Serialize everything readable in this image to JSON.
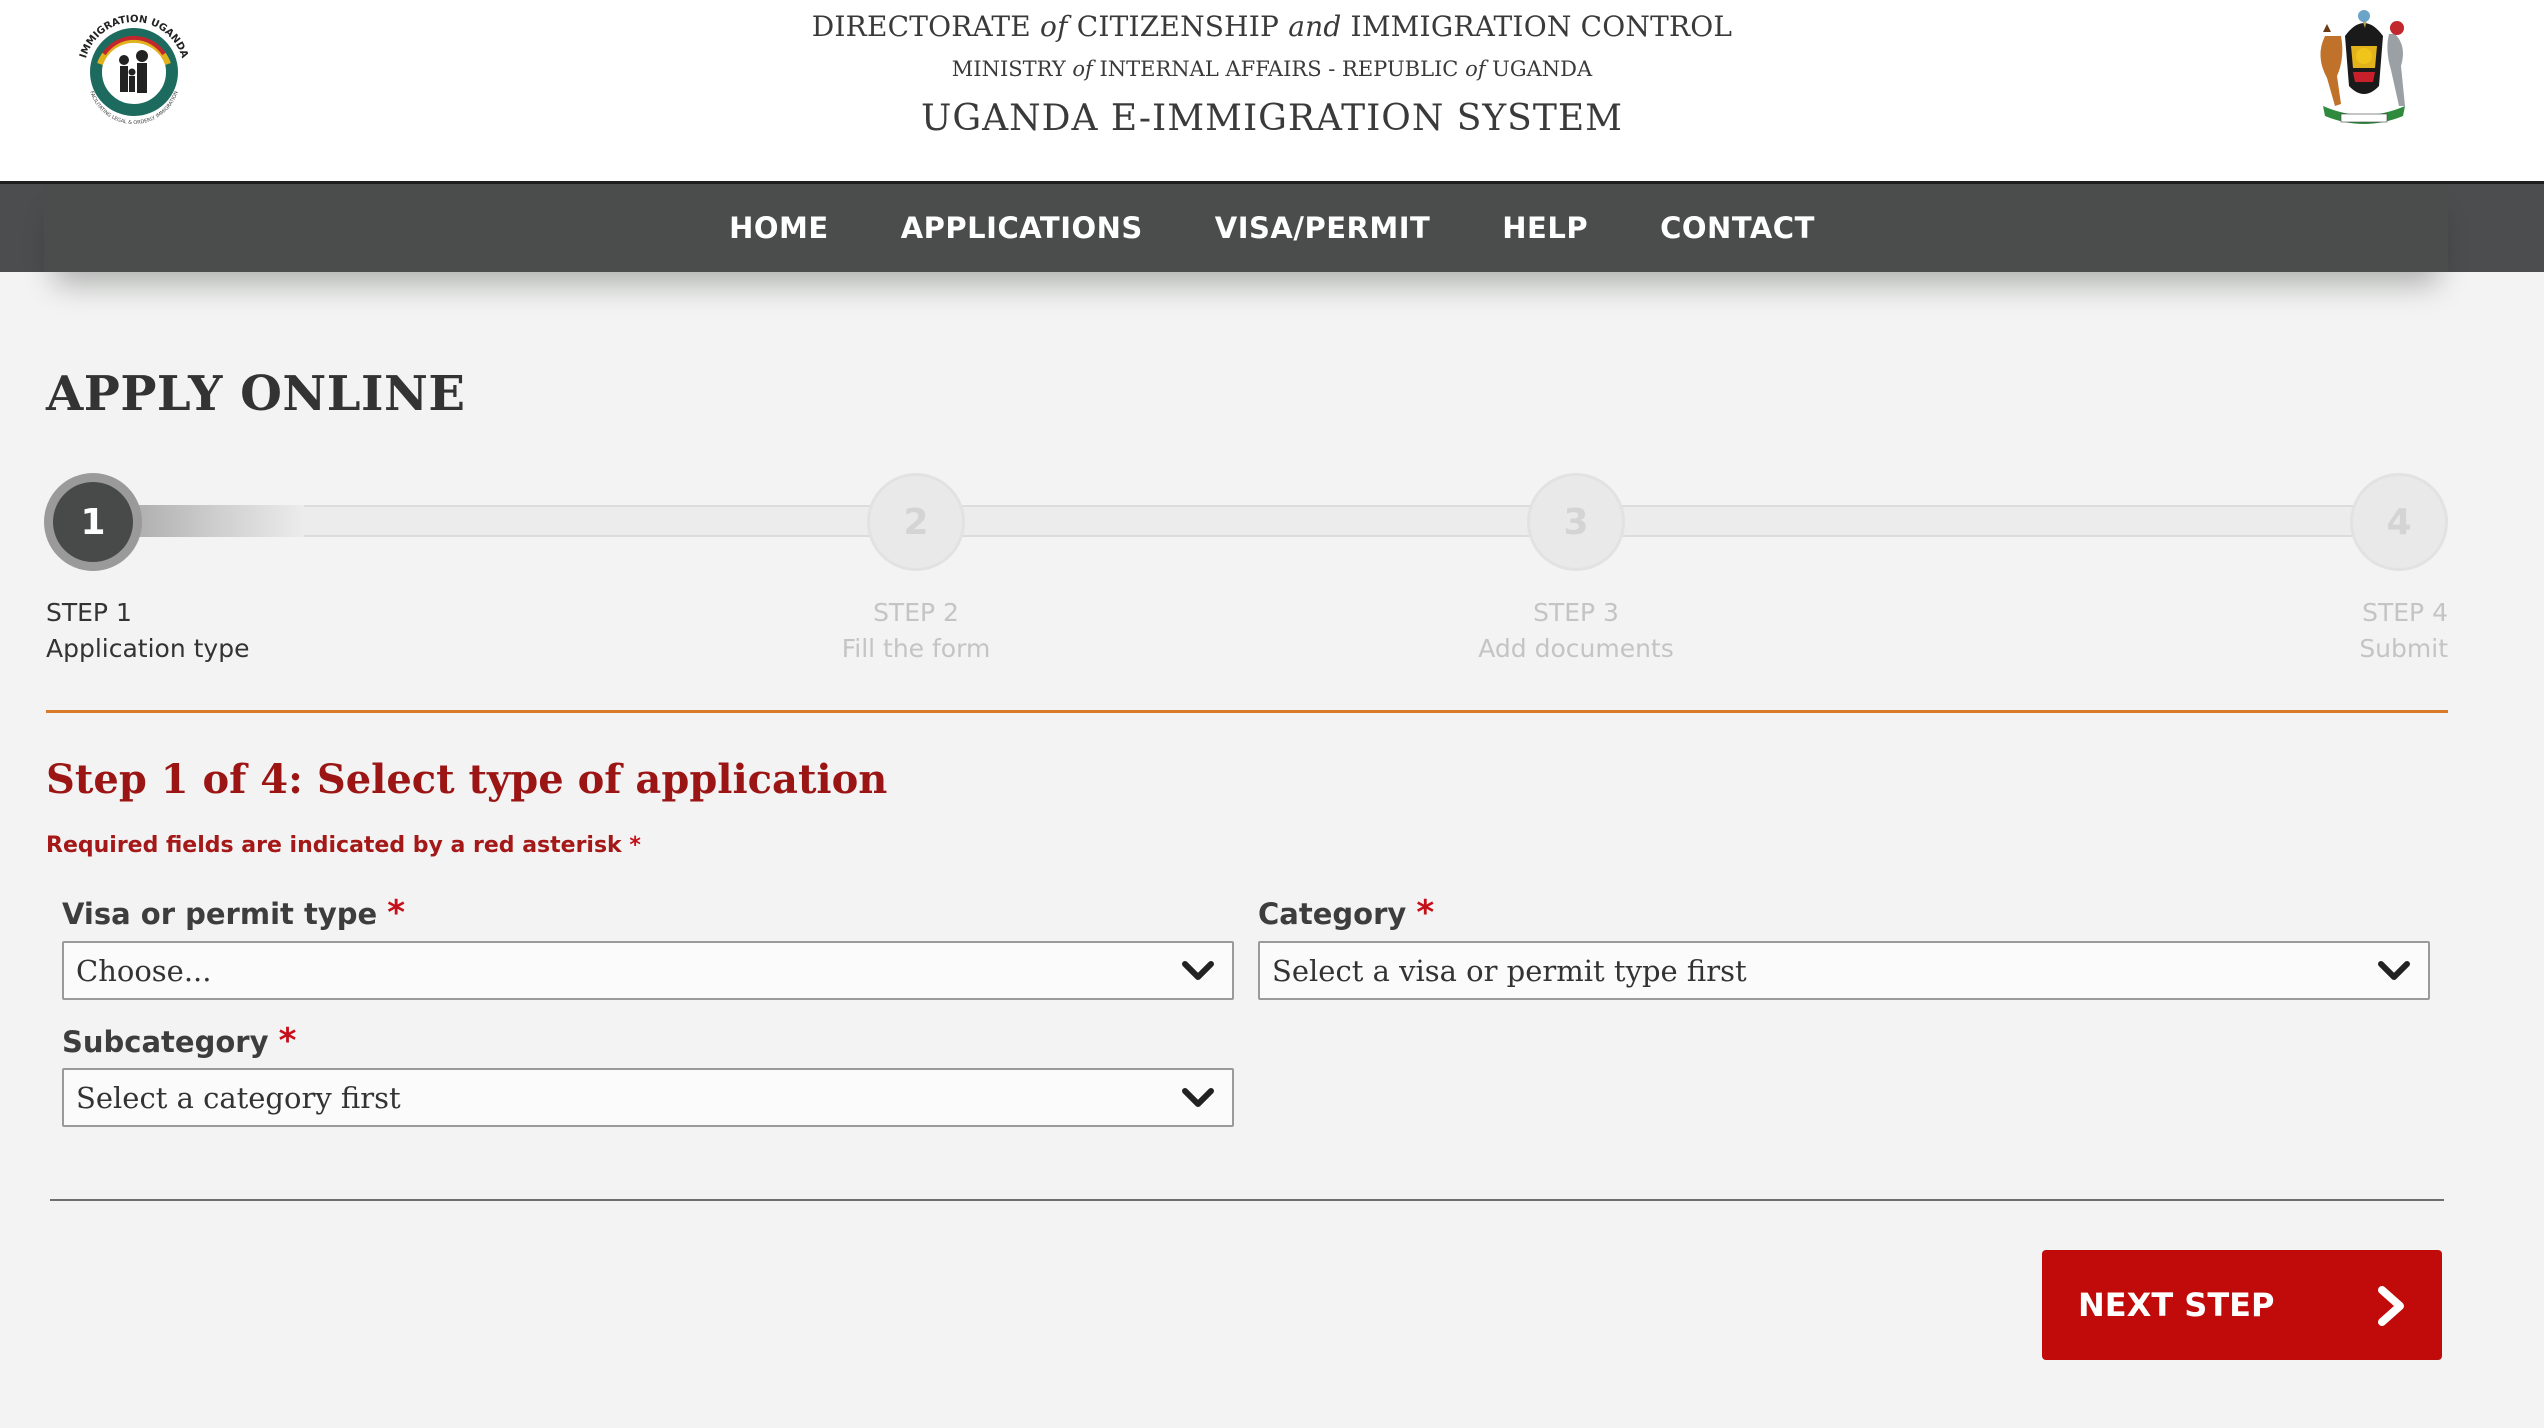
{
  "header": {
    "line1_a": "DIRECTORATE ",
    "line1_of": "of",
    "line1_b": " CITIZENSHIP ",
    "line1_and": "and",
    "line1_c": " IMMIGRATION CONTROL",
    "line2_a": "MINISTRY ",
    "line2_of1": "of",
    "line2_b": " INTERNAL AFFAIRS -  REPUBLIC ",
    "line2_of2": "of",
    "line2_c": " UGANDA",
    "system_title": "UGANDA E-IMMIGRATION SYSTEM",
    "left_logo_text_top": "IMMIGRATION UGANDA",
    "left_logo_text_bottom": "FACILITATING LEGAL & ORDERLY IMMIGRATION",
    "left_logo_icon": "immigration-uganda-logo",
    "right_logo_icon": "uganda-coat-of-arms"
  },
  "nav": {
    "items": [
      "HOME",
      "APPLICATIONS",
      "VISA/PERMIT",
      "HELP",
      "CONTACT"
    ]
  },
  "page": {
    "title": "APPLY ONLINE"
  },
  "stepper": {
    "current_step": 1,
    "steps": [
      {
        "number": "1",
        "label": "STEP 1",
        "sub": "Application type"
      },
      {
        "number": "2",
        "label": "STEP 2",
        "sub": "Fill the form"
      },
      {
        "number": "3",
        "label": "STEP 3",
        "sub": "Add documents"
      },
      {
        "number": "4",
        "label": "STEP 4",
        "sub": "Submit"
      }
    ]
  },
  "form": {
    "heading_prefix": "Step 1 of 4: ",
    "heading_main": "Select type of application",
    "required_note": "Required fields are indicated by a red asterisk ",
    "asterisk": "*",
    "fields": {
      "visa_type": {
        "label": "Visa or permit type ",
        "value": "Choose..."
      },
      "category": {
        "label": "Category ",
        "value": "Select a visa or permit type first"
      },
      "subcategory": {
        "label": "Subcategory ",
        "value": "Select a category first"
      }
    },
    "next_button": "NEXT STEP"
  },
  "colors": {
    "nav_bg": "#4c4d4e",
    "accent_red": "#c10a0a",
    "heading_red": "#9c1515",
    "divider_orange": "#d9792a",
    "page_bg": "#f2f3f2"
  }
}
